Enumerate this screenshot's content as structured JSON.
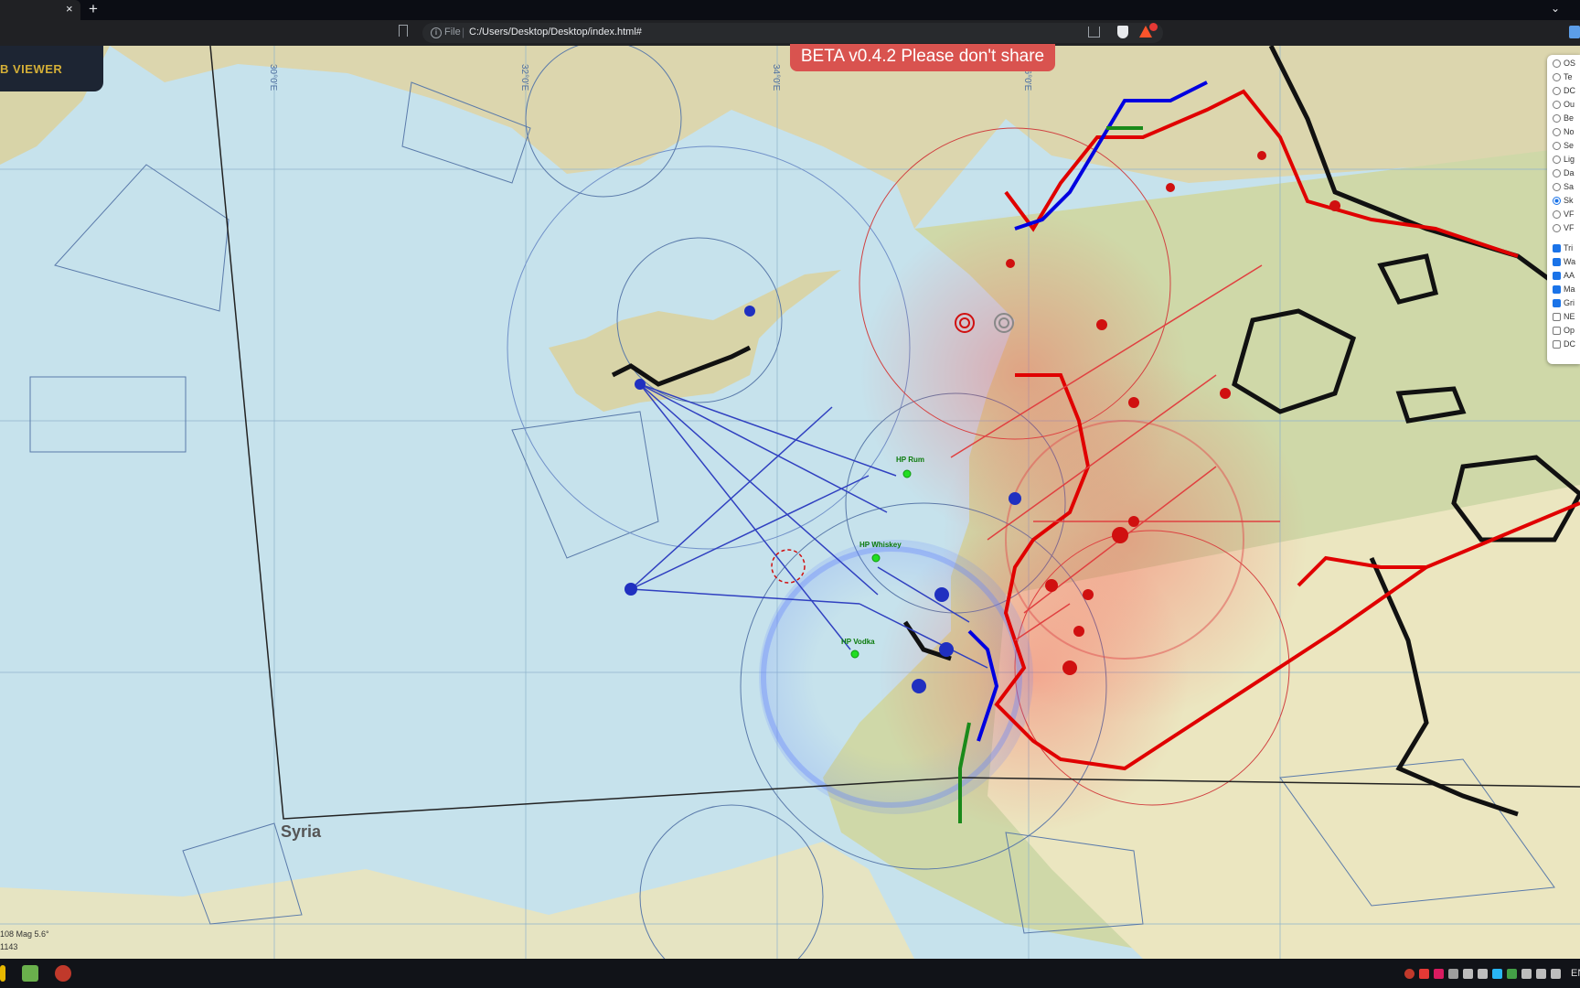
{
  "browser": {
    "tab_close": "×",
    "new_tab": "+",
    "tab_menu": "⌄",
    "scheme": "File",
    "scheme_sep": "|",
    "url": "C:/Users/Desktop/Desktop/index.html#"
  },
  "app": {
    "logo": "B VIEWER",
    "beta_banner": "BETA v0.4.2 Please don't share"
  },
  "map": {
    "region_label": "Syria",
    "mag_readout": "108 Mag 5.6°",
    "coord_readout": "1143",
    "grid_labels": [
      "30°0'E",
      "32°0'E",
      "34°0'E",
      "36°0'E"
    ],
    "waypoints": [
      "HP Rum",
      "HP Whiskey",
      "HP Vodka"
    ],
    "colors": {
      "sea": "#c6e2ec",
      "land": "#cfd8a8",
      "red_border": "#e00000",
      "blue_border": "#0000e0",
      "routes": "#3040c0",
      "waypoint": "#22dd22"
    }
  },
  "layers": {
    "base": [
      {
        "label": "OS",
        "selected": false
      },
      {
        "label": "Te",
        "selected": false
      },
      {
        "label": "DC",
        "selected": false
      },
      {
        "label": "Ou",
        "selected": false
      },
      {
        "label": "Be",
        "selected": false
      },
      {
        "label": "No",
        "selected": false
      },
      {
        "label": "Se",
        "selected": false
      },
      {
        "label": "Lig",
        "selected": false
      },
      {
        "label": "Da",
        "selected": false
      },
      {
        "label": "Sa",
        "selected": false
      },
      {
        "label": "Sk",
        "selected": true
      },
      {
        "label": "VF",
        "selected": false
      },
      {
        "label": "VF",
        "selected": false
      }
    ],
    "overlays": [
      {
        "label": "Tri",
        "checked": true
      },
      {
        "label": "Wa",
        "checked": true
      },
      {
        "label": "AA",
        "checked": true
      },
      {
        "label": "Ma",
        "checked": true
      },
      {
        "label": "Gri",
        "checked": true
      },
      {
        "label": "NE",
        "checked": false
      },
      {
        "label": "Op",
        "checked": false
      },
      {
        "label": "DC",
        "checked": false
      }
    ]
  },
  "taskbar": {
    "tray_lang": "EN"
  }
}
